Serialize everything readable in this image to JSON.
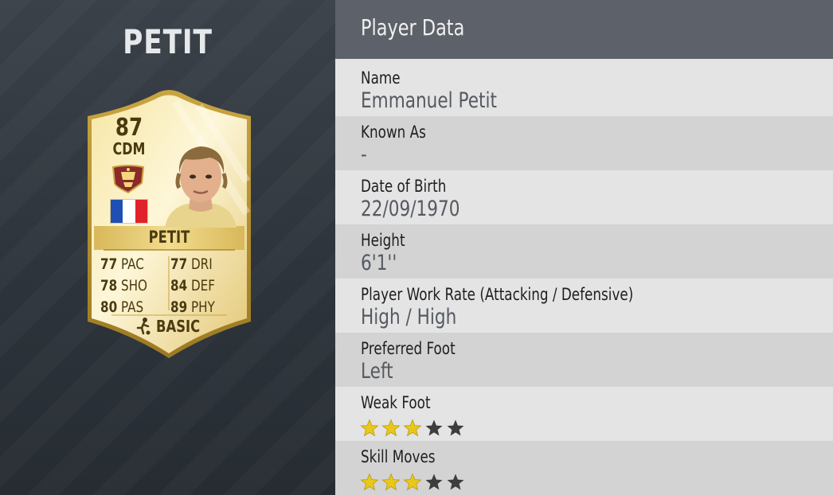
{
  "left": {
    "title": "PETIT",
    "card": {
      "rating": "87",
      "position": "CDM",
      "name": "PETIT",
      "stats": [
        [
          {
            "value": "77",
            "label": "PAC"
          },
          {
            "value": "77",
            "label": "DRI"
          }
        ],
        [
          {
            "value": "78",
            "label": "SHO"
          },
          {
            "value": "84",
            "label": "DEF"
          }
        ],
        [
          {
            "value": "80",
            "label": "PAS"
          },
          {
            "value": "89",
            "label": "PHY"
          }
        ]
      ],
      "chemistry": "BASIC",
      "nation_flag": {
        "colors": [
          "#1f4fb5",
          "#ffffff",
          "#e0232b"
        ]
      },
      "club_badge_icon": "legend-crest-icon",
      "colors": {
        "gold_light": "#f6e9b0",
        "gold": "#dcc166",
        "gold_dark": "#b6922f",
        "text": "#4a3a10"
      }
    }
  },
  "right": {
    "header": "Player Data",
    "rows": [
      {
        "label": "Name",
        "value": "Emmanuel Petit"
      },
      {
        "label": "Known As",
        "value": "-"
      },
      {
        "label": "Date of Birth",
        "value": "22/09/1970"
      },
      {
        "label": "Height",
        "value": "6'1''"
      },
      {
        "label": "Player Work Rate (Attacking / Defensive)",
        "value": "High / High"
      },
      {
        "label": "Preferred Foot",
        "value": "Left"
      },
      {
        "label": "Weak Foot",
        "stars": 3,
        "max_stars": 5
      },
      {
        "label": "Skill Moves",
        "stars": 3,
        "max_stars": 5
      }
    ],
    "colors": {
      "star_filled": "#e9c81c",
      "star_empty": "#3d3d3d"
    }
  }
}
